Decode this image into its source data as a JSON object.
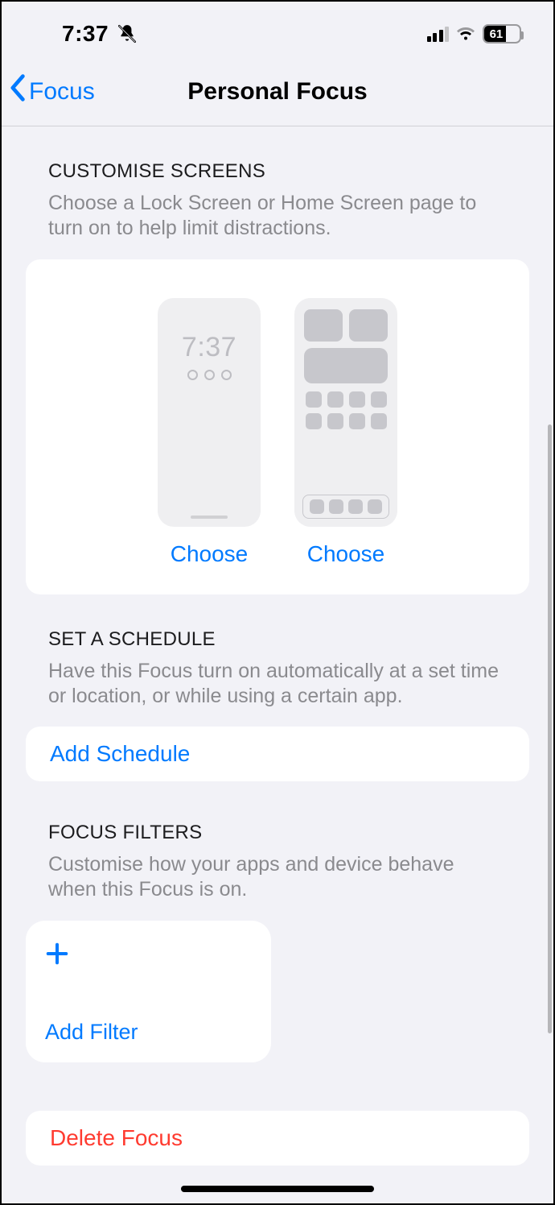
{
  "status": {
    "time": "7:37",
    "battery_percent": "61"
  },
  "nav": {
    "back_label": "Focus",
    "title": "Personal Focus"
  },
  "customise": {
    "header": "CUSTOMISE SCREENS",
    "desc": "Choose a Lock Screen or Home Screen page to turn on to help limit distractions.",
    "lock_time": "7:37",
    "choose_lock": "Choose",
    "choose_home": "Choose"
  },
  "schedule": {
    "header": "SET A SCHEDULE",
    "desc": "Have this Focus turn on automatically at a set time or location, or while using a certain app.",
    "button": "Add Schedule"
  },
  "filters": {
    "header": "FOCUS FILTERS",
    "desc": "Customise how your apps and device behave when this Focus is on.",
    "button": "Add Filter"
  },
  "delete_label": "Delete Focus"
}
